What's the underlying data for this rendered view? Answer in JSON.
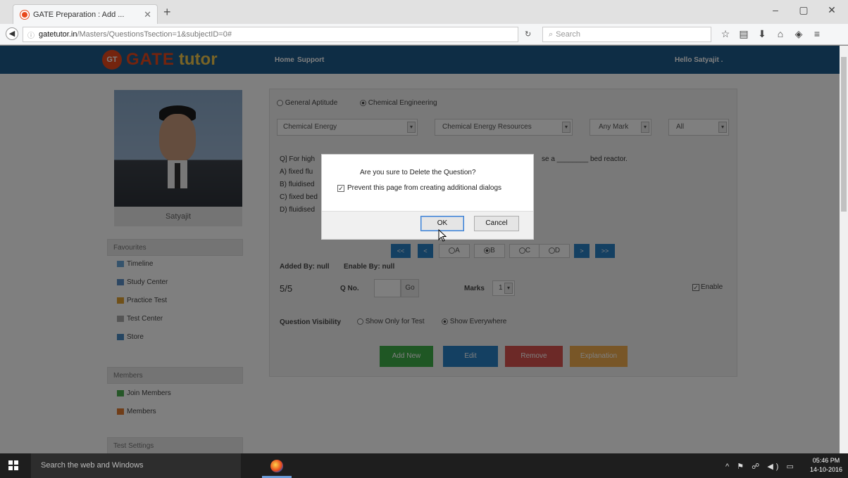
{
  "browser": {
    "tab_title": "GATE Preparation : Add ...",
    "tab_close": "✕",
    "new_tab": "+",
    "url_domain": "gatetutor.in",
    "url_path": "/Masters/QuestionsTsection=1&subjectID=0#",
    "search_placeholder": "Search",
    "window_minimize": "–",
    "window_maximize": "▢",
    "window_close": "✕"
  },
  "site": {
    "logo_badge": "GT",
    "logo_gate": "GATE",
    "logo_tutor": "tutor",
    "nav_home": "Home",
    "nav_support": "Support",
    "user_greeting": "Hello Satyajit ."
  },
  "sidebar": {
    "profile_name": "Satyajit",
    "favourites_heading": "Favourites",
    "favourites": [
      "Timeline",
      "Study Center",
      "Practice Test",
      "Test Center",
      "Store"
    ],
    "members_heading": "Members",
    "members": [
      "Join Members",
      "Members"
    ],
    "settings_heading": "Test Settings"
  },
  "panel": {
    "radio_general": "General Aptitude",
    "radio_chemical": "Chemical Engineering",
    "select_subject": "Chemical Energy",
    "select_topic": "Chemical Energy Resources",
    "select_marks": "Any Mark",
    "select_filter": "All",
    "question_start": "Q] For high",
    "question_end": "se a ________ bed reactor.",
    "option_a": "A) fixed flu",
    "option_b": "B) fluidised",
    "option_c": "C) fixed bed",
    "option_d": "D) fluidised",
    "nav_first": "<<",
    "nav_prev": "<",
    "nav_next": ">",
    "nav_last": ">>",
    "opt_a": "A",
    "opt_b": "B",
    "opt_c": "C",
    "opt_d": "D",
    "added_by": "Added By: null",
    "enable_by": "Enable By: null",
    "count": "5/5",
    "qno_label": "Q No.",
    "go_label": "Go",
    "marks_label": "Marks",
    "marks_value": "1",
    "enable_label": "Enable",
    "visibility_label": "Question Visibility",
    "vis_test": "Show Only for Test",
    "vis_everywhere": "Show Everywhere",
    "btn_add": "Add New",
    "btn_edit": "Edit",
    "btn_remove": "Remove",
    "btn_explanation": "Explanation"
  },
  "dialog": {
    "message": "Are you sure to Delete the Question?",
    "checkbox_label": "Prevent this page from creating additional dialogs",
    "checkbox_checked": true,
    "ok": "OK",
    "cancel": "Cancel"
  },
  "taskbar": {
    "search_placeholder": "Search the web and Windows",
    "time": "05:46 PM",
    "date": "14-10-2016"
  },
  "colors": {
    "site_header": "#1d5a8a",
    "brand_orange": "#e8491d",
    "btn_add": "#3fae49",
    "btn_edit": "#2980c4",
    "btn_remove": "#d9534f",
    "btn_explanation": "#f0ad4e"
  }
}
